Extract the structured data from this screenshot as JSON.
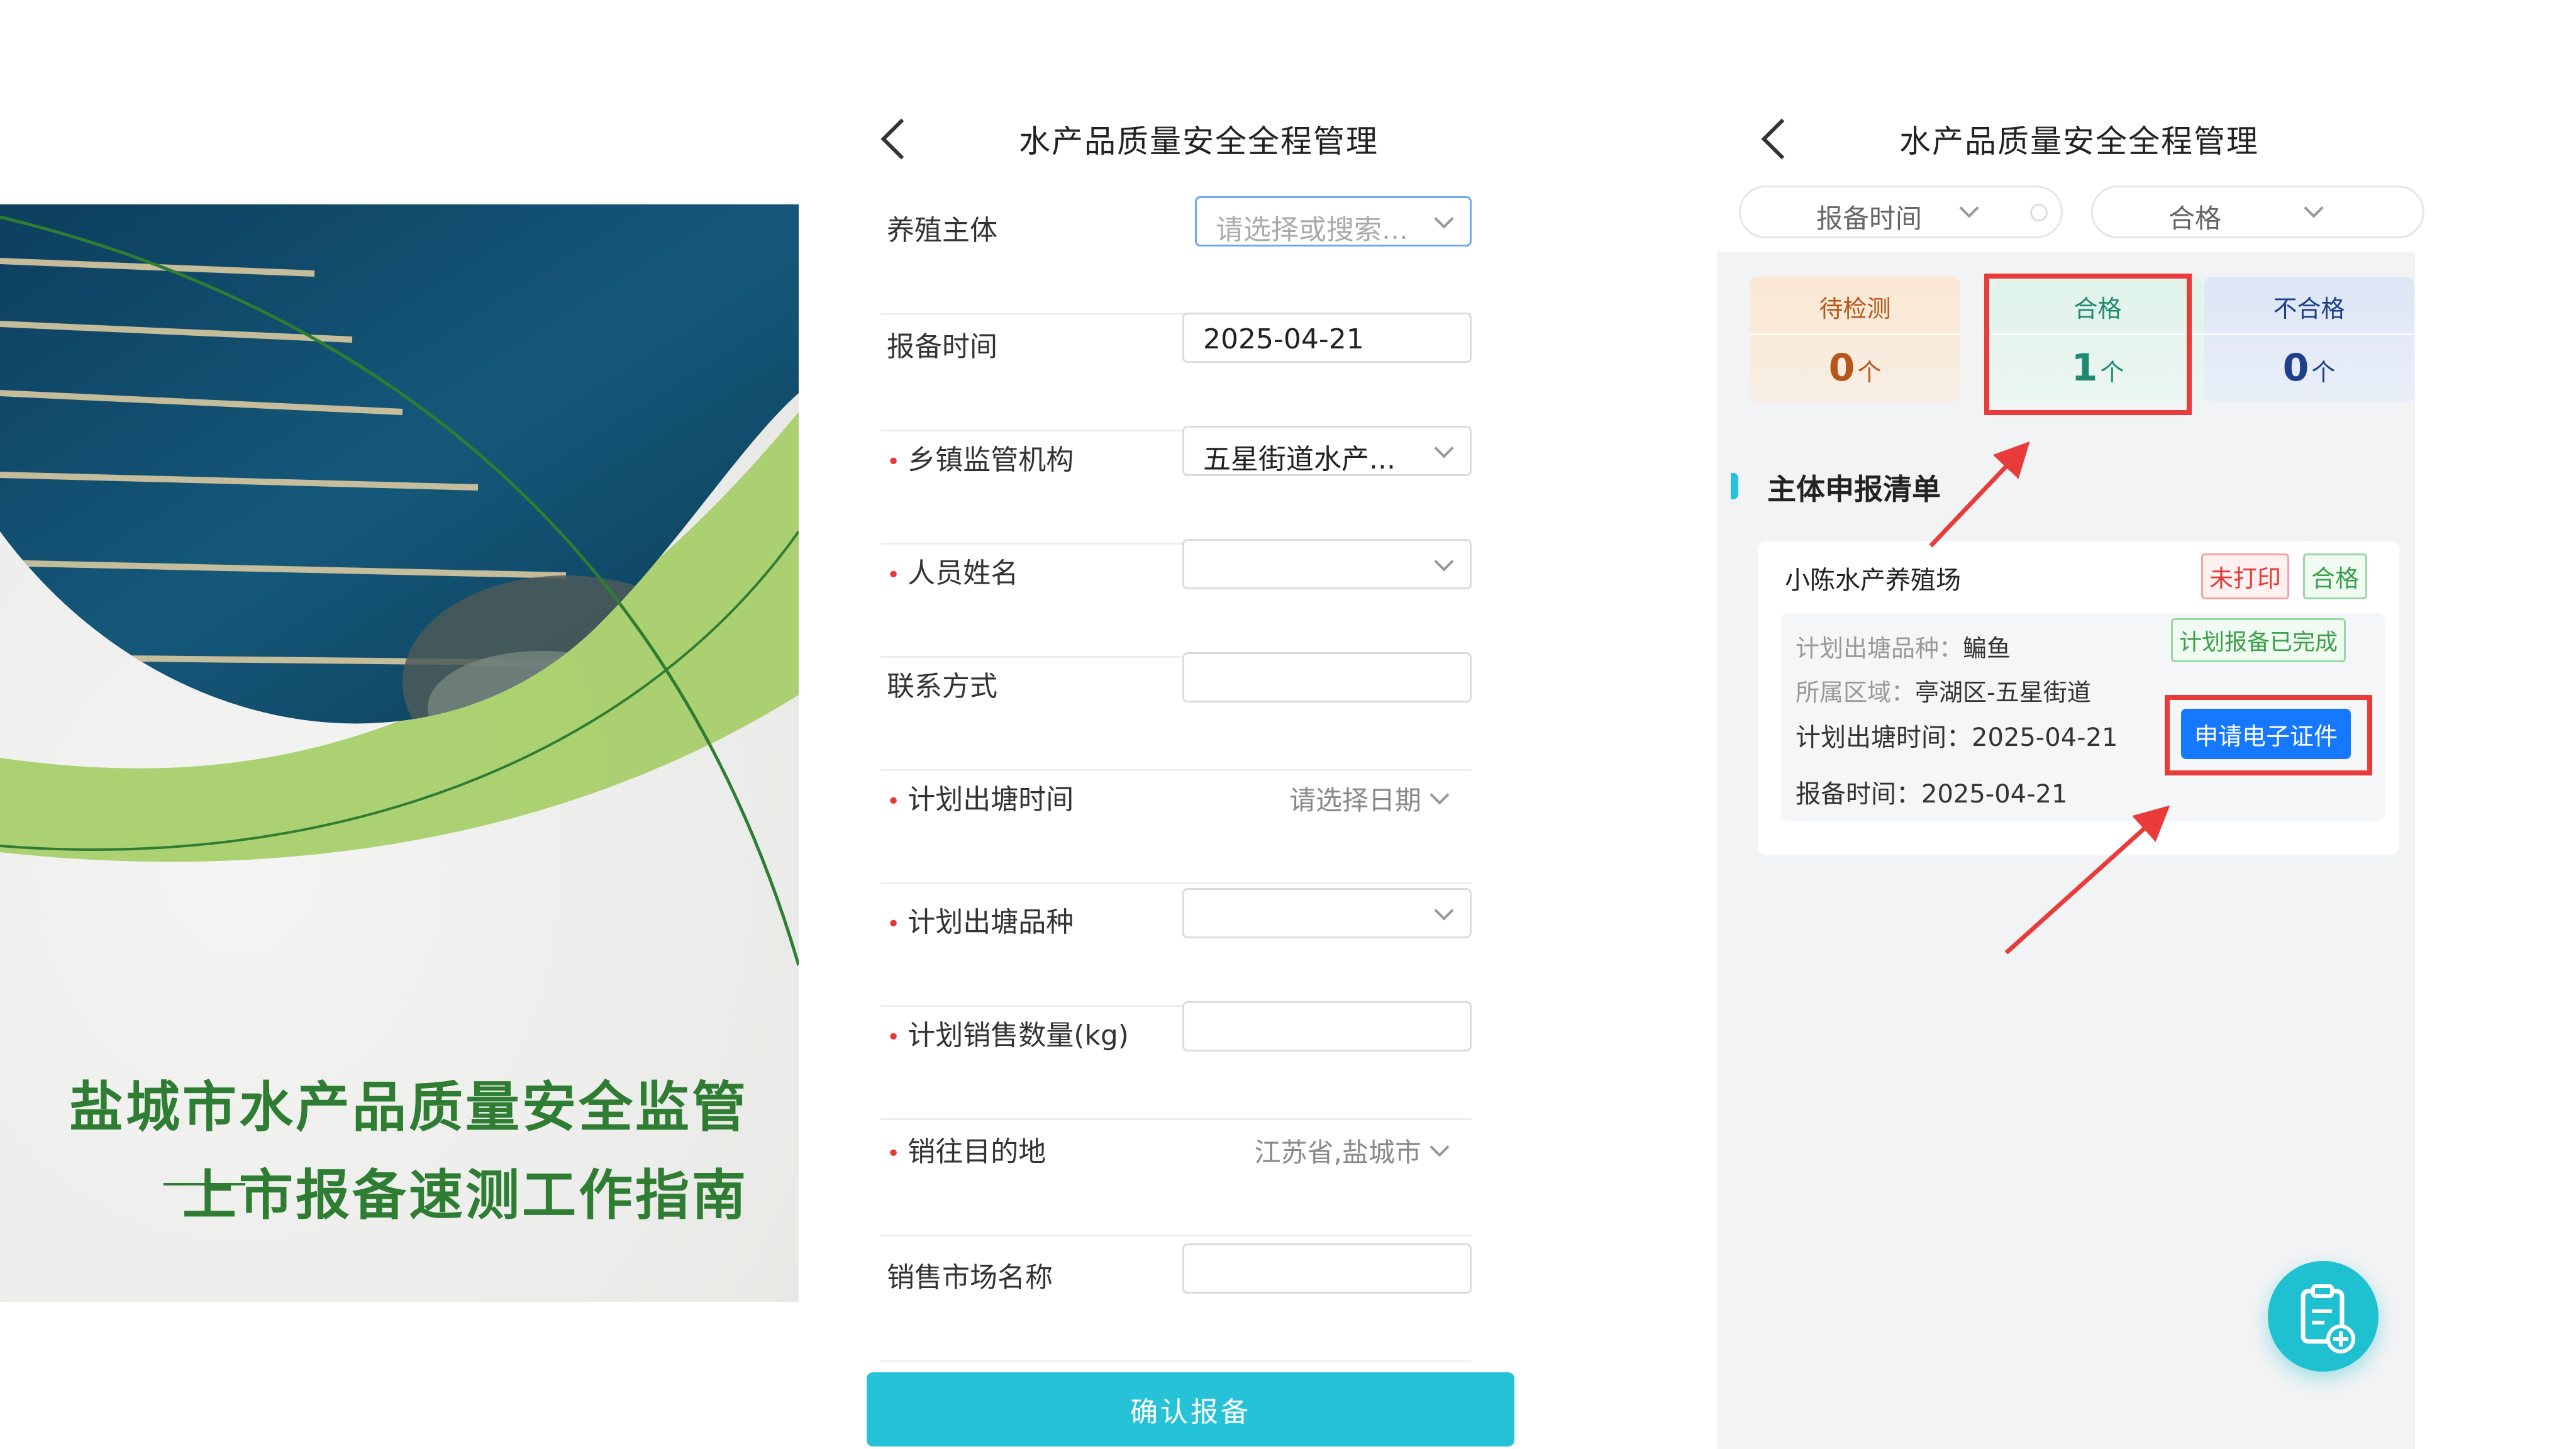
{
  "cover": {
    "title_line1": "盐城市水产品质量安全监管",
    "title_line2": "上市报备速测工作指南"
  },
  "form_screen": {
    "nav_title": "水产品质量安全全程管理",
    "rows": [
      {
        "label": "养殖主体",
        "required": false,
        "type": "select",
        "value": "",
        "placeholder": "请选择或搜索..."
      },
      {
        "label": "报备时间",
        "required": false,
        "type": "input",
        "value": "2025-04-21"
      },
      {
        "label": "乡镇监管机构",
        "required": true,
        "type": "select",
        "value": "五星街道水产..."
      },
      {
        "label": "人员姓名",
        "required": true,
        "type": "select",
        "value": ""
      },
      {
        "label": "联系方式",
        "required": false,
        "type": "input",
        "value": ""
      },
      {
        "label": "计划出塘时间",
        "required": true,
        "type": "plain",
        "value": "请选择日期"
      },
      {
        "label": "计划出塘品种",
        "required": true,
        "type": "select",
        "value": ""
      },
      {
        "label": "计划销售数量(kg)",
        "required": true,
        "type": "input",
        "value": ""
      },
      {
        "label": "销往目的地",
        "required": true,
        "type": "plain",
        "value": "江苏省,盐城市"
      },
      {
        "label": "销售市场名称",
        "required": false,
        "type": "input",
        "value": ""
      }
    ],
    "confirm_label": "确认报备"
  },
  "list_screen": {
    "nav_title": "水产品质量安全全程管理",
    "filter_time": "报备时间",
    "filter_status": "合格",
    "stats": [
      {
        "label": "待检测",
        "value": "0",
        "unit": "个",
        "color": "#b7561a"
      },
      {
        "label": "合格",
        "value": "1",
        "unit": "个",
        "color": "#1f8a6f"
      },
      {
        "label": "不合格",
        "value": "0",
        "unit": "个",
        "color": "#1e3f8a"
      }
    ],
    "section_title": "主体申报清单",
    "record": {
      "name": "小陈水产养殖场",
      "tag_print": "未打印",
      "tag_status": "合格",
      "tag_plan": "计划报备已完成",
      "species_key": "计划出塘品种：",
      "species_val": "鳊鱼",
      "area_key": "所属区域：",
      "area_val": "亭湖区-五星街道",
      "out_time": "计划出塘时间：2025-04-21",
      "report_time": "报备时间：2025-04-21",
      "apply_button": "申请电子证件"
    }
  },
  "colors": {
    "accent": "#26c2d8",
    "green": "#2e7d32",
    "highlight": "#ea3b3b",
    "apply_blue": "#1677ff"
  }
}
